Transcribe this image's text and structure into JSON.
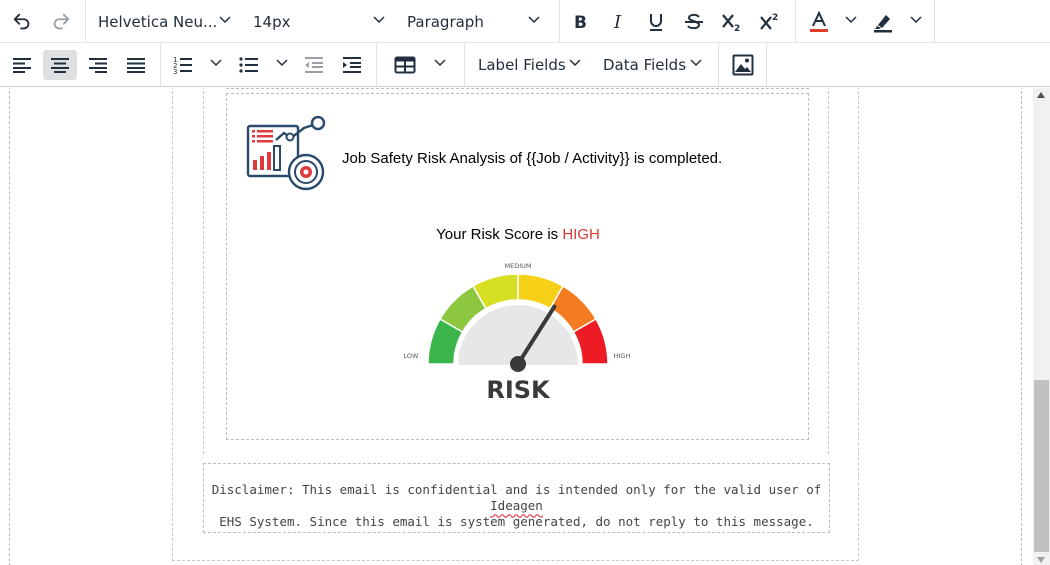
{
  "toolbar": {
    "row1": {
      "undo_icon": "undo-icon",
      "redo_icon": "redo-icon",
      "font_family": "Helvetica Neu...",
      "font_size": "14px",
      "block_format": "Paragraph",
      "bold_icon": "bold-icon",
      "italic_icon": "italic-icon",
      "underline_icon": "underline-icon",
      "strikethrough_icon": "strikethrough-icon",
      "subscript_icon": "subscript-icon",
      "superscript_icon": "superscript-icon",
      "text_color_icon": "text-color-icon",
      "highlight_icon": "highlight-icon",
      "text_color": "#e03e2d"
    },
    "row2": {
      "align_left_icon": "align-left-icon",
      "align_center_icon": "align-center-icon",
      "align_right_icon": "align-right-icon",
      "justify_icon": "justify-icon",
      "numbered_list_icon": "numbered-list-icon",
      "bullet_list_icon": "bullet-list-icon",
      "outdent_icon": "outdent-icon",
      "indent_icon": "indent-icon",
      "table_icon": "table-icon",
      "label_fields": "Label Fields",
      "data_fields": "Data Fields",
      "image_icon": "image-icon",
      "active": "align-center"
    }
  },
  "content": {
    "analysis_icon": "analytics-report-icon",
    "headline": "Job Safety Risk Analysis of {{Job / Activity}} is completed.",
    "score_prefix": "Your Risk Score is ",
    "score_value": "HIGH",
    "score_color": "#d93732",
    "gauge": {
      "label_low": "LOW",
      "label_medium": "MEDIUM",
      "label_high": "HIGH",
      "title": "RISK",
      "level": 0.68,
      "segment_colors": [
        "#39b54a",
        "#8dc63f",
        "#d7df23",
        "#f7d117",
        "#f47c20",
        "#ed1c24"
      ]
    },
    "disclaimer_line1_a": "Disclaimer: This email is confidential and is intended only for the valid user of ",
    "disclaimer_line1_b": "Ideagen",
    "disclaimer_line2": "EHS System. Since this email is system generated, do not reply to this message."
  }
}
